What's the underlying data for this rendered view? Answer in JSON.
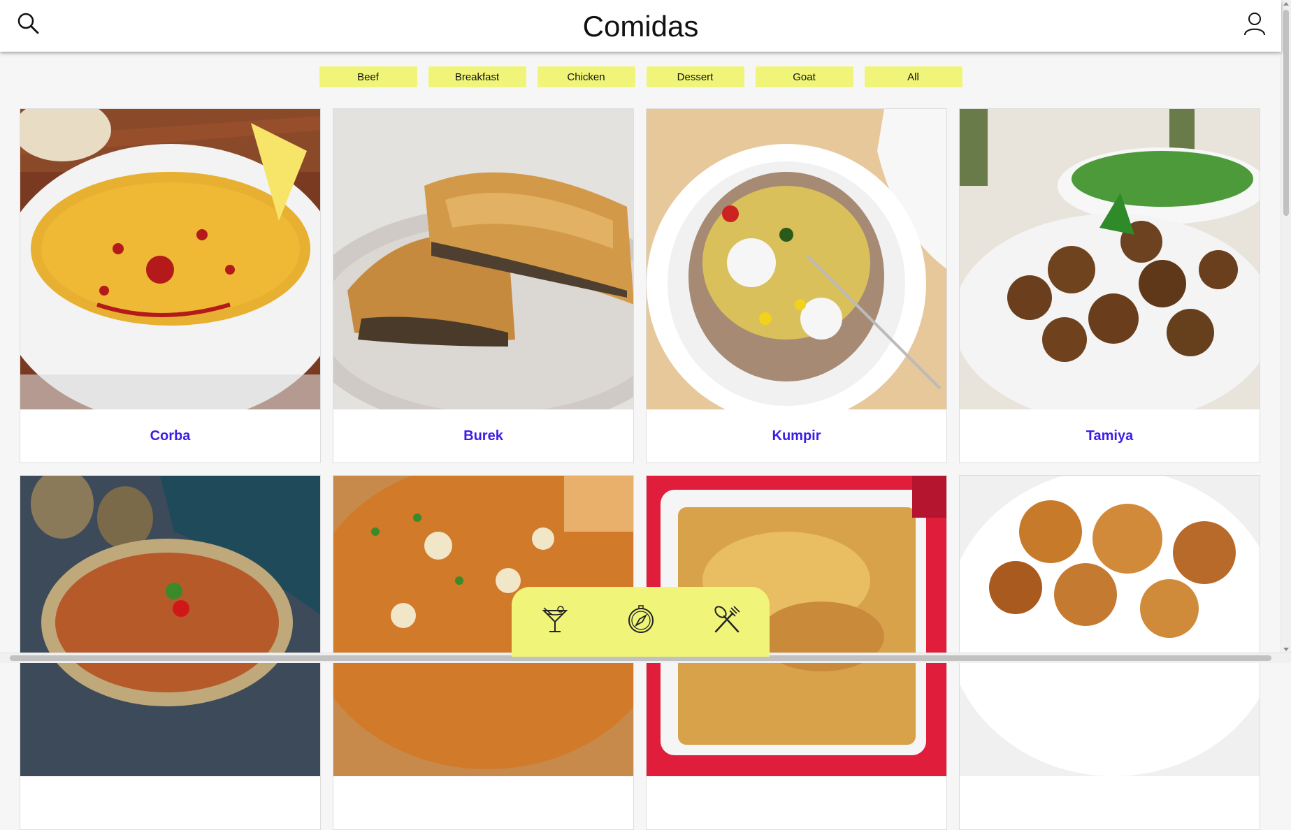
{
  "header": {
    "title": "Comidas",
    "search_icon": "search-icon",
    "user_icon": "user-icon"
  },
  "filters": [
    "Beef",
    "Breakfast",
    "Chicken",
    "Dessert",
    "Goat",
    "All"
  ],
  "meals": [
    {
      "name": "Corba"
    },
    {
      "name": "Burek"
    },
    {
      "name": "Kumpir"
    },
    {
      "name": "Tamiya"
    },
    {
      "name": ""
    },
    {
      "name": ""
    },
    {
      "name": ""
    },
    {
      "name": ""
    }
  ],
  "bottom_nav": {
    "items": [
      "cocktail-icon",
      "compass-icon",
      "fork-spoon-icon"
    ]
  },
  "colors": {
    "accent": "#f0f57a",
    "meal_title": "#3b1ee6"
  }
}
